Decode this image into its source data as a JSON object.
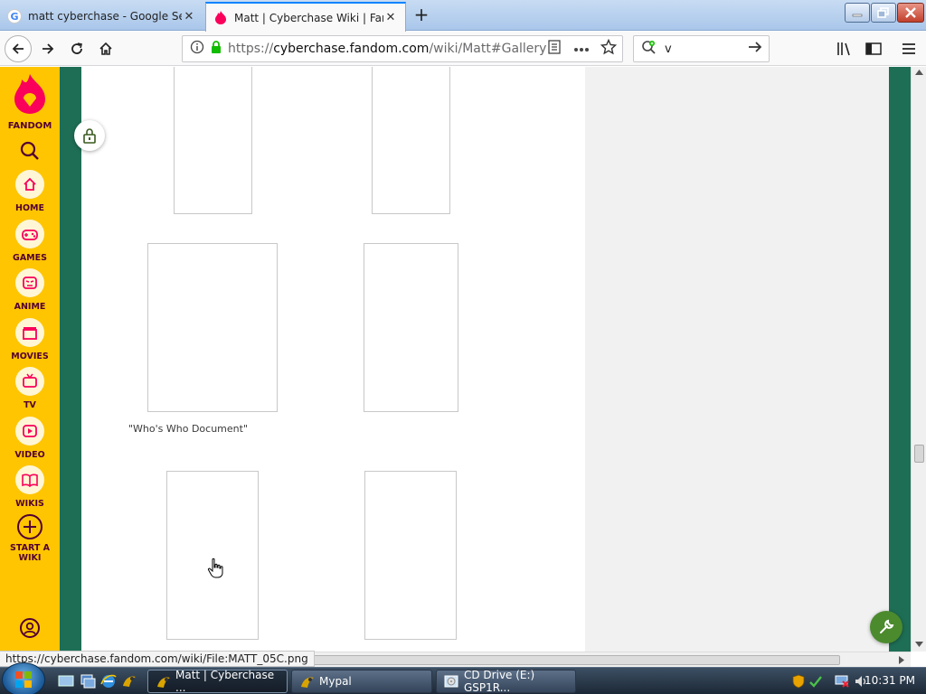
{
  "browser": {
    "tabs": [
      {
        "title": "matt cyberchase - Google Search",
        "active": false
      },
      {
        "title": "Matt | Cyberchase Wiki | Fandom",
        "active": true
      }
    ],
    "url_prefix": "https://",
    "url_host": "cyberchase.fandom.com",
    "url_path": "/wiki/Matt#Gallery",
    "search_value": "v",
    "status_link": "https://cyberchase.fandom.com/wiki/File:MATT_05C.png"
  },
  "rail": {
    "logo_label": "FANDOM",
    "items": [
      {
        "label": "HOME",
        "icon": "home-icon"
      },
      {
        "label": "GAMES",
        "icon": "gamepad-icon"
      },
      {
        "label": "ANIME",
        "icon": "anime-face-icon"
      },
      {
        "label": "MOVIES",
        "icon": "clapperboard-icon"
      },
      {
        "label": "TV",
        "icon": "tv-icon"
      },
      {
        "label": "VIDEO",
        "icon": "play-icon"
      },
      {
        "label": "WIKIS",
        "icon": "book-icon"
      },
      {
        "label": "START A WIKI",
        "icon": "plus-circle-icon"
      }
    ]
  },
  "gallery": {
    "caption": "\"Who's Who Document\""
  },
  "taskbar": {
    "tasks": [
      {
        "label": "Matt | Cyberchase ...",
        "active": true
      },
      {
        "label": "Mypal",
        "active": false
      },
      {
        "label": "CD Drive (E:) GSP1R...",
        "active": false
      }
    ],
    "clock": "10:31 PM"
  },
  "colors": {
    "fandom_yellow": "#ffc500",
    "fandom_purple": "#520032",
    "community_green": "#1e6e55",
    "fandom_pink": "#fa005a"
  }
}
